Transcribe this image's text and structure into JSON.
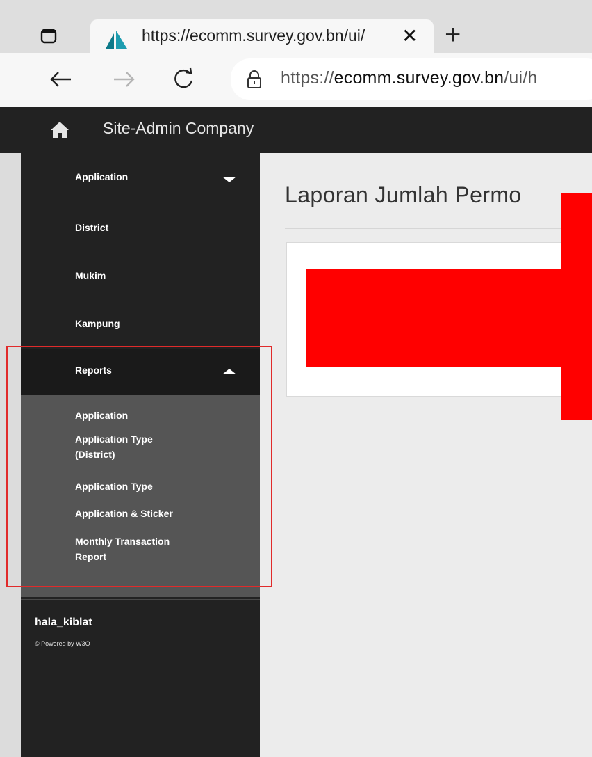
{
  "browser": {
    "tab_title": "https://ecomm.survey.gov.bn/ui/",
    "tab_close": "✕",
    "new_tab": "+",
    "url_prefix": "https://",
    "url_host": "ecomm.survey.gov.bn",
    "url_path": "/ui/h"
  },
  "app": {
    "brand": "Site-Admin Company"
  },
  "sidebar": {
    "items": [
      {
        "label": "Application"
      },
      {
        "label": "District"
      },
      {
        "label": "Mukim"
      },
      {
        "label": "Kampung"
      },
      {
        "label": "Reports"
      }
    ],
    "submenu": [
      {
        "label": "Application"
      },
      {
        "label": "Application Type (District)"
      },
      {
        "label": "Application Type"
      },
      {
        "label": "Application & Sticker"
      },
      {
        "label": "Monthly Transaction Report"
      }
    ],
    "username": "hala_kiblat",
    "powered": "© Powered by W3O"
  },
  "main": {
    "page_title": "Laporan Jumlah Permo"
  },
  "annotation": {
    "box_color": "#e12b2b",
    "arrow_color": "#ff0000"
  }
}
